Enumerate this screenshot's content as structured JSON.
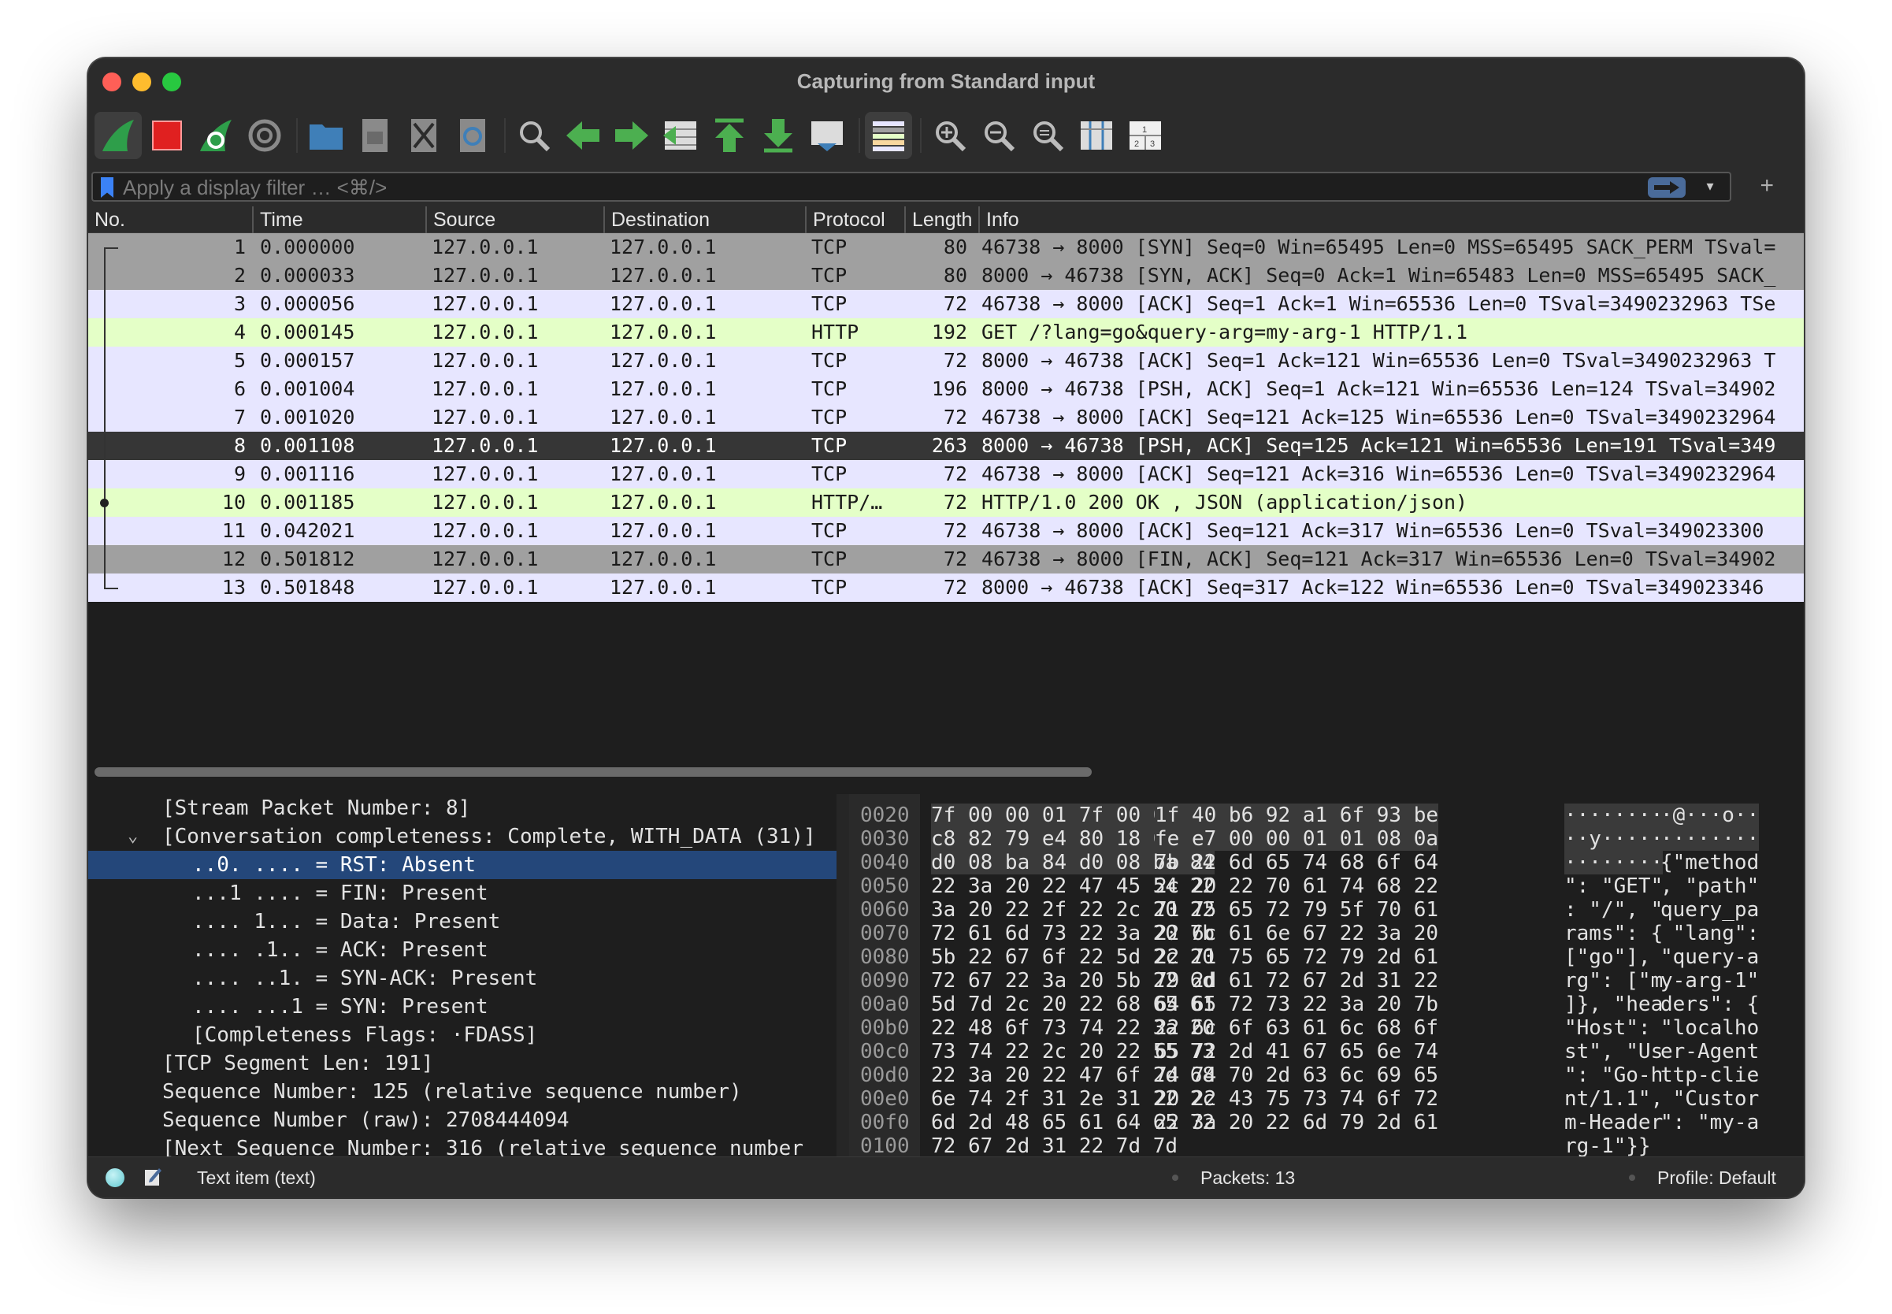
{
  "window": {
    "title": "Capturing from Standard input"
  },
  "filter": {
    "placeholder": "Apply a display filter … <⌘/>"
  },
  "toolbar": {
    "icons": [
      "shark-fin-start-icon",
      "stop-capture-icon",
      "restart-capture-icon",
      "capture-options-icon",
      "open-file-icon",
      "save-file-icon",
      "close-file-icon",
      "reload-file-icon",
      "find-packet-icon",
      "go-back-icon",
      "go-forward-icon",
      "go-to-packet-icon",
      "first-packet-icon",
      "last-packet-icon",
      "auto-scroll-icon",
      "colorize-icon",
      "zoom-in-icon",
      "zoom-out-icon",
      "zoom-reset-icon",
      "resize-columns-icon",
      "layout-icon"
    ]
  },
  "columns": [
    "No.",
    "Time",
    "Source",
    "Destination",
    "Protocol",
    "Length",
    "Info"
  ],
  "colors": {
    "tcp": "#e7e6ff",
    "tcp_gray": "#a0a0a0",
    "http": "#e4ffc7",
    "selected": "#363636",
    "detail_selected": "#24477a"
  },
  "packets": [
    {
      "no": "1",
      "time": "0.000000",
      "src": "127.0.0.1",
      "dst": "127.0.0.1",
      "proto": "TCP",
      "len": "80",
      "info": "46738 → 8000 [SYN] Seq=0 Win=65495 Len=0 MSS=65495 SACK_PERM TSval=",
      "style": "r-gray"
    },
    {
      "no": "2",
      "time": "0.000033",
      "src": "127.0.0.1",
      "dst": "127.0.0.1",
      "proto": "TCP",
      "len": "80",
      "info": "8000 → 46738 [SYN, ACK] Seq=0 Ack=1 Win=65483 Len=0 MSS=65495 SACK_",
      "style": "r-gray"
    },
    {
      "no": "3",
      "time": "0.000056",
      "src": "127.0.0.1",
      "dst": "127.0.0.1",
      "proto": "TCP",
      "len": "72",
      "info": "46738 → 8000 [ACK] Seq=1 Ack=1 Win=65536 Len=0 TSval=3490232963 TSe",
      "style": "r-tcp"
    },
    {
      "no": "4",
      "time": "0.000145",
      "src": "127.0.0.1",
      "dst": "127.0.0.1",
      "proto": "HTTP",
      "len": "192",
      "info": "GET /?lang=go&query-arg=my-arg-1 HTTP/1.1",
      "style": "r-http"
    },
    {
      "no": "5",
      "time": "0.000157",
      "src": "127.0.0.1",
      "dst": "127.0.0.1",
      "proto": "TCP",
      "len": "72",
      "info": "8000 → 46738 [ACK] Seq=1 Ack=121 Win=65536 Len=0 TSval=3490232963 T",
      "style": "r-tcp"
    },
    {
      "no": "6",
      "time": "0.001004",
      "src": "127.0.0.1",
      "dst": "127.0.0.1",
      "proto": "TCP",
      "len": "196",
      "info": "8000 → 46738 [PSH, ACK] Seq=1 Ack=121 Win=65536 Len=124 TSval=34902",
      "style": "r-tcp"
    },
    {
      "no": "7",
      "time": "0.001020",
      "src": "127.0.0.1",
      "dst": "127.0.0.1",
      "proto": "TCP",
      "len": "72",
      "info": "46738 → 8000 [ACK] Seq=121 Ack=125 Win=65536 Len=0 TSval=3490232964",
      "style": "r-tcp"
    },
    {
      "no": "8",
      "time": "0.001108",
      "src": "127.0.0.1",
      "dst": "127.0.0.1",
      "proto": "TCP",
      "len": "263",
      "info": "8000 → 46738 [PSH, ACK] Seq=125 Ack=121 Win=65536 Len=191 TSval=349",
      "style": "r-sel"
    },
    {
      "no": "9",
      "time": "0.001116",
      "src": "127.0.0.1",
      "dst": "127.0.0.1",
      "proto": "TCP",
      "len": "72",
      "info": "46738 → 8000 [ACK] Seq=121 Ack=316 Win=65536 Len=0 TSval=3490232964",
      "style": "r-tcp"
    },
    {
      "no": "10",
      "time": "0.001185",
      "src": "127.0.0.1",
      "dst": "127.0.0.1",
      "proto": "HTTP/…",
      "len": "72",
      "info": "HTTP/1.0 200 OK , JSON (application/json)",
      "style": "r-http"
    },
    {
      "no": "11",
      "time": "0.042021",
      "src": "127.0.0.1",
      "dst": "127.0.0.1",
      "proto": "TCP",
      "len": "72",
      "info": "46738 → 8000 [ACK] Seq=121 Ack=317 Win=65536 Len=0 TSval=349023300",
      "style": "r-tcp"
    },
    {
      "no": "12",
      "time": "0.501812",
      "src": "127.0.0.1",
      "dst": "127.0.0.1",
      "proto": "TCP",
      "len": "72",
      "info": "46738 → 8000 [FIN, ACK] Seq=121 Ack=317 Win=65536 Len=0 TSval=34902",
      "style": "r-gray"
    },
    {
      "no": "13",
      "time": "0.501848",
      "src": "127.0.0.1",
      "dst": "127.0.0.1",
      "proto": "TCP",
      "len": "72",
      "info": "8000 → 46738 [ACK] Seq=317 Ack=122 Win=65536 Len=0 TSval=349023346",
      "style": "r-tcp"
    }
  ],
  "details": [
    {
      "text": "[Stream Packet Number: 8]",
      "indent": 1
    },
    {
      "text": "[Conversation completeness: Complete, WITH_DATA (31)]",
      "indent": 1,
      "expanded": true
    },
    {
      "text": "..0. .... = RST: Absent",
      "indent": 2,
      "selected": true
    },
    {
      "text": "...1 .... = FIN: Present",
      "indent": 2
    },
    {
      "text": ".... 1... = Data: Present",
      "indent": 2
    },
    {
      "text": ".... .1.. = ACK: Present",
      "indent": 2
    },
    {
      "text": ".... ..1. = SYN-ACK: Present",
      "indent": 2
    },
    {
      "text": ".... ...1 = SYN: Present",
      "indent": 2
    },
    {
      "text": "[Completeness Flags: ·FDASS]",
      "indent": 2
    },
    {
      "text": "[TCP Segment Len: 191]",
      "indent": 1
    },
    {
      "text": "Sequence Number: 125    (relative sequence number)",
      "indent": 1
    },
    {
      "text": "Sequence Number (raw): 2708444094",
      "indent": 1
    },
    {
      "text": "[Next Sequence Number: 316    (relative sequence number",
      "indent": 1
    }
  ],
  "hex": [
    {
      "off": "0020",
      "h1": "7f 00 00 01 7f 00 00 01",
      "h2": "1f 40 b6 92 a1 6f 93 be",
      "a1": "········",
      "a2": "·@···o··"
    },
    {
      "off": "0030",
      "h1": "c8 82 79 e4 80 18 01 00",
      "h2": "fe e7 00 00 01 01 08 0a",
      "a1": "··y·····",
      "a2": "········"
    },
    {
      "off": "0040",
      "h1": "d0 08 ba 84 d0 08 ba 84",
      "h2": "7b 22 6d 65 74 68 6f 64",
      "a1": "········",
      "a2": "{\"method"
    },
    {
      "off": "0050",
      "h1": "22 3a 20 22 47 45 54 22",
      "h2": "2c 20 22 70 61 74 68 22",
      "a1": "\": \"GET\"",
      "a2": ", \"path\""
    },
    {
      "off": "0060",
      "h1": "3a 20 22 2f 22 2c 20 22",
      "h2": "71 75 65 72 79 5f 70 61",
      "a1": ": \"/\", \"",
      "a2": "query_pa"
    },
    {
      "off": "0070",
      "h1": "72 61 6d 73 22 3a 20 7b",
      "h2": "22 6c 61 6e 67 22 3a 20",
      "a1": "rams\": {",
      "a2": " \"lang\":"
    },
    {
      "off": "0080",
      "h1": "5b 22 67 6f 22 5d 2c 20",
      "h2": "22 71 75 65 72 79 2d 61",
      "a1": "[\"go\"], ",
      "a2": "\"query-a"
    },
    {
      "off": "0090",
      "h1": "72 67 22 3a 20 5b 22 6d",
      "h2": "79 2d 61 72 67 2d 31 22",
      "a1": "rg\": [\"m",
      "a2": "y-arg-1\""
    },
    {
      "off": "00a0",
      "h1": "5d 7d 2c 20 22 68 65 61",
      "h2": "64 65 72 73 22 3a 20 7b",
      "a1": "]}, \"hea",
      "a2": "ders\": {"
    },
    {
      "off": "00b0",
      "h1": "22 48 6f 73 74 22 3a 20",
      "h2": "22 6c 6f 63 61 6c 68 6f",
      "a1": "\"Host\": ",
      "a2": "\"localho"
    },
    {
      "off": "00c0",
      "h1": "73 74 22 2c 20 22 55 73",
      "h2": "65 72 2d 41 67 65 6e 74",
      "a1": "st\", \"Us",
      "a2": "er-Agent"
    },
    {
      "off": "00d0",
      "h1": "22 3a 20 22 47 6f 2d 68",
      "h2": "74 74 70 2d 63 6c 69 65",
      "a1": "\": \"Go-h",
      "a2": "ttp-clie"
    },
    {
      "off": "00e0",
      "h1": "6e 74 2f 31 2e 31 22 2c",
      "h2": "20 22 43 75 73 74 6f 72",
      "a1": "nt/1.1\",",
      "a2": " \"Custor"
    },
    {
      "off": "00f0",
      "h1": "6d 2d 48 65 61 64 65 72",
      "h2": "22 3a 20 22 6d 79 2d 61",
      "a1": "m-Header",
      "a2": "\": \"my-a"
    },
    {
      "off": "0100",
      "h1": "72 67 2d 31 22 7d 7d",
      "h2": "",
      "a1": "rg-1\"}}",
      "a2": ""
    }
  ],
  "status": {
    "item": "Text item (text)",
    "packets": "Packets: 13",
    "profile": "Profile: Default"
  }
}
